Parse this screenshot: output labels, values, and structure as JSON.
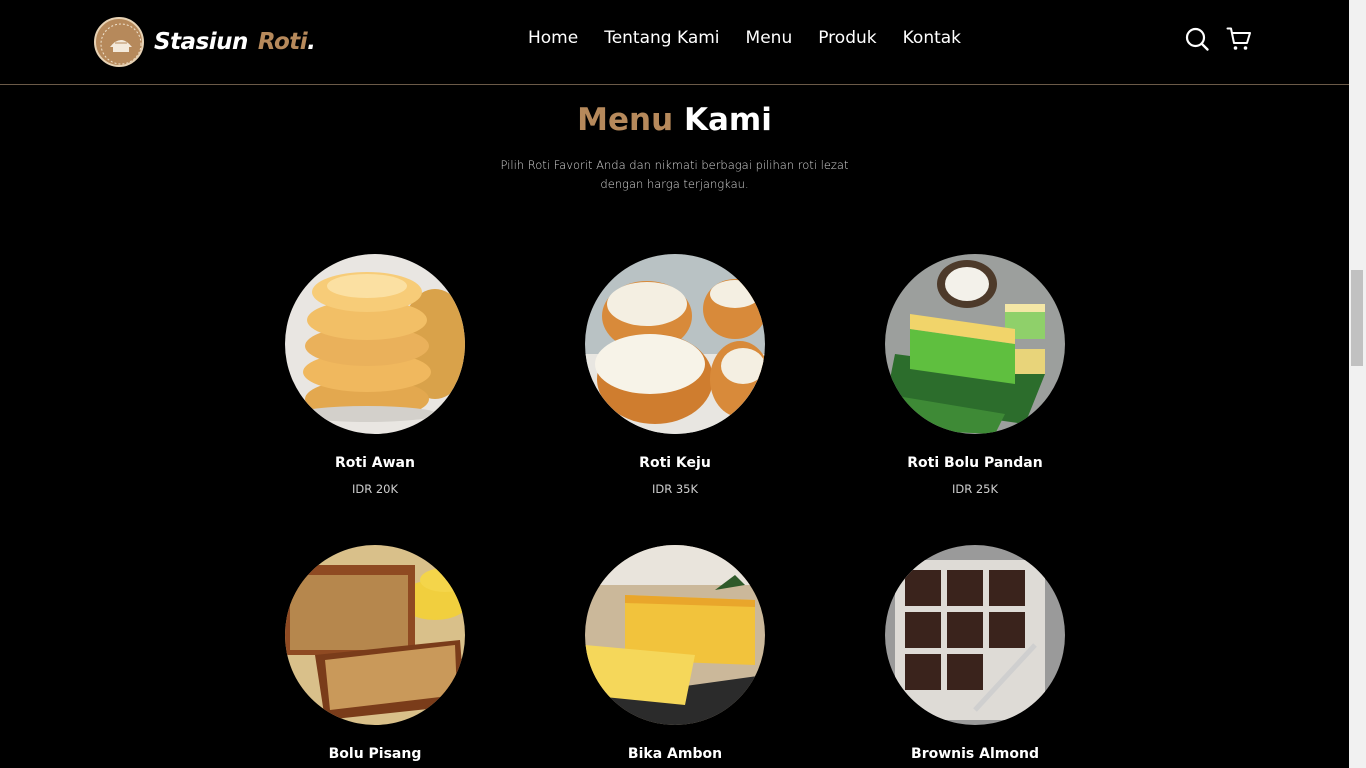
{
  "header": {
    "brand_part1": "Stasiun",
    "brand_part2": "Roti",
    "brand_part3": ".",
    "nav": [
      "Home",
      "Tentang Kami",
      "Menu",
      "Produk",
      "Kontak"
    ],
    "icons": [
      "search-icon",
      "cart-icon"
    ]
  },
  "section": {
    "title_part1": "Menu",
    "title_part2": "Kami",
    "description": "Pilih Roti Favorit Anda dan nikmati berbagai pilihan roti lezat dengan harga terjangkau."
  },
  "menu": [
    {
      "name": "Roti Awan",
      "price": "IDR 20K"
    },
    {
      "name": "Roti Keju",
      "price": "IDR 35K"
    },
    {
      "name": "Roti Bolu Pandan",
      "price": "IDR 25K"
    },
    {
      "name": "Bolu Pisang",
      "price": ""
    },
    {
      "name": "Bika Ambon",
      "price": ""
    },
    {
      "name": "Brownis Almond",
      "price": ""
    }
  ],
  "colors": {
    "accent": "#b6895b",
    "background": "#000000",
    "text": "#ffffff"
  }
}
